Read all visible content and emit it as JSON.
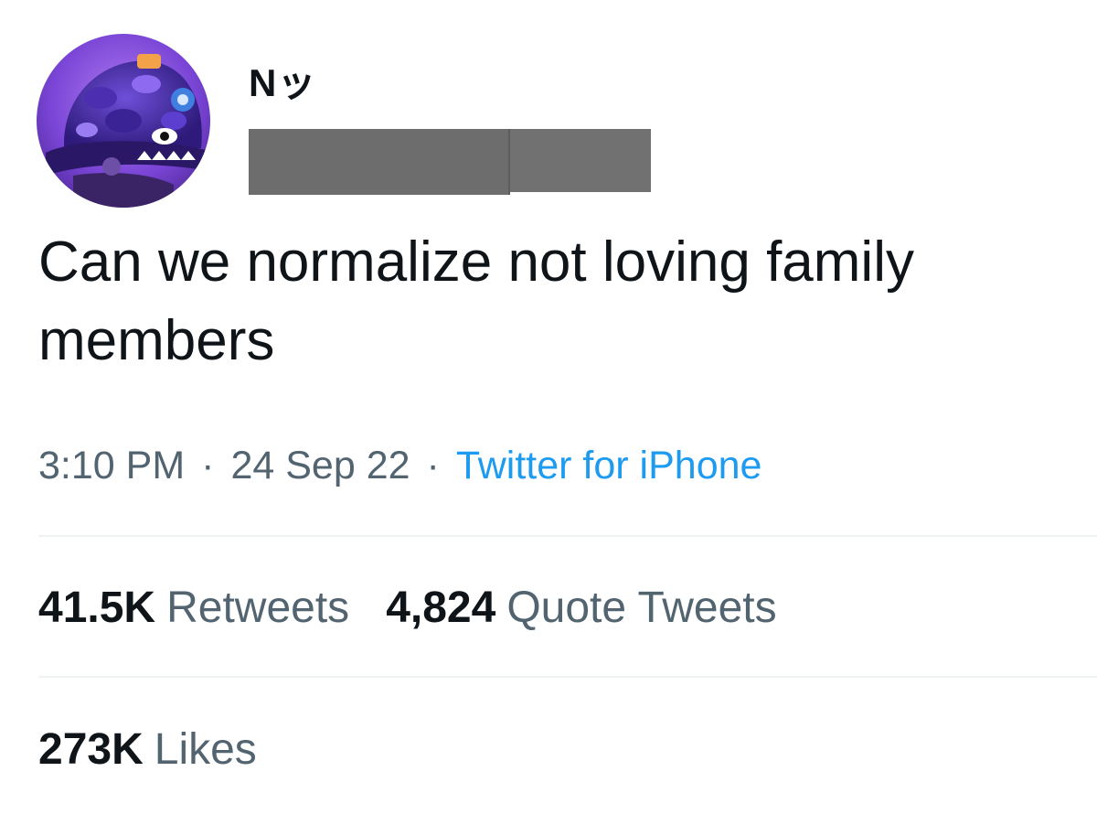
{
  "tweet": {
    "author": {
      "display_name": "Nッ",
      "handle": ""
    },
    "text": "Can we normalize not loving family members",
    "time": "3:10 PM",
    "separator": "·",
    "date": "24 Sep 22",
    "source": "Twitter for iPhone"
  },
  "stats": {
    "retweets": {
      "count": "41.5K",
      "label": "Retweets"
    },
    "quote_tweets": {
      "count": "4,824",
      "label": "Quote Tweets"
    },
    "likes": {
      "count": "273K",
      "label": "Likes"
    }
  },
  "colors": {
    "text": "#0f1419",
    "secondary": "#536471",
    "link": "#1d9bf0",
    "divider": "#eff3f4",
    "redaction": "#6d6d6d",
    "avatar_bg": "#6a3fc4"
  },
  "icons": {
    "avatar": "purple-camo-hat-avatar-icon"
  }
}
